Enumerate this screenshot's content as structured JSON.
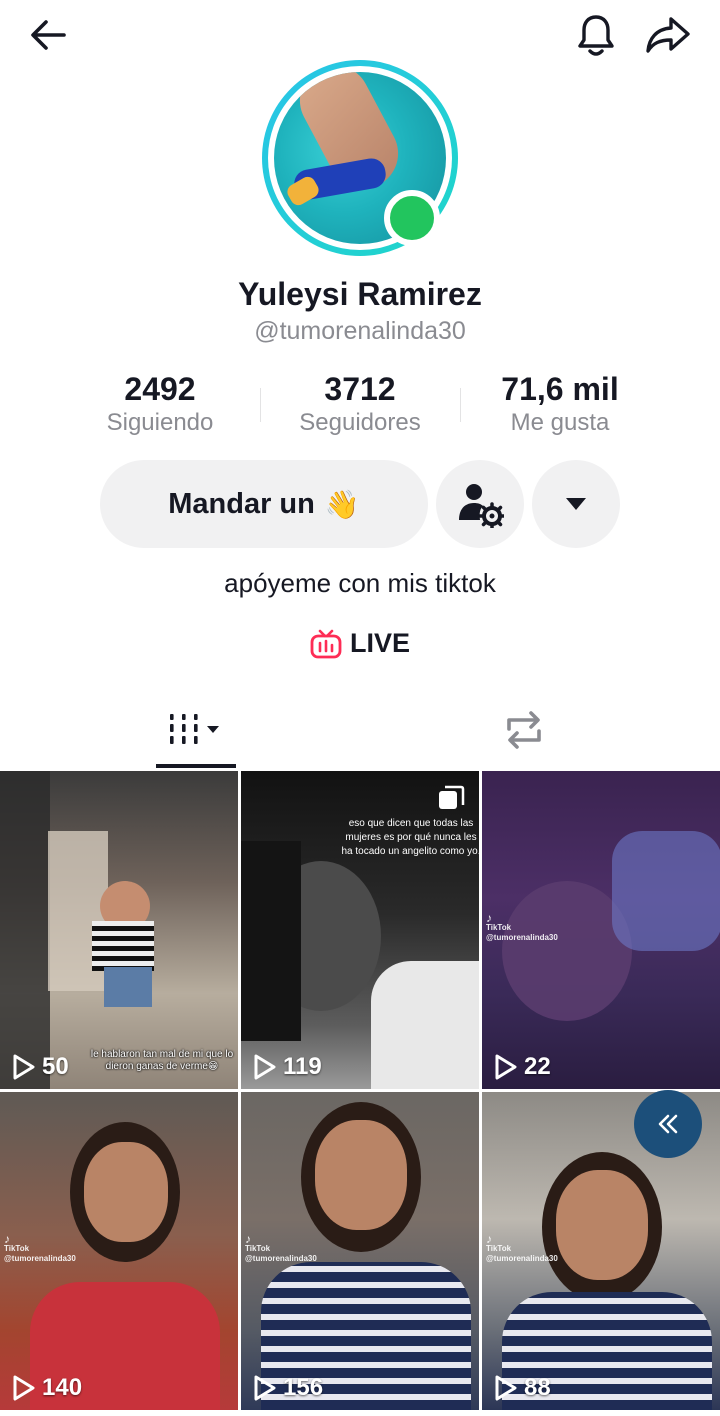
{
  "header": {
    "back_icon": "arrow-left-icon",
    "notifications_icon": "bell-icon",
    "share_icon": "share-arrow-icon"
  },
  "profile": {
    "name": "Yuleysi Ramirez",
    "handle": "@tumorenalinda30",
    "bio": "apóyeme con mis tiktok",
    "online_color": "#22c55e",
    "ring_color": "#29c4e8"
  },
  "stats": [
    {
      "value": "2492",
      "label": "Siguiendo"
    },
    {
      "value": "3712",
      "label": "Seguidores"
    },
    {
      "value": "71,6 mil",
      "label": "Me gusta"
    }
  ],
  "actions": {
    "message_label": "Mandar un",
    "message_emoji": "👋",
    "friends_icon": "user-settings-icon",
    "more_icon": "caret-down-icon"
  },
  "live": {
    "label": "LIVE",
    "color": "#fe2c55"
  },
  "tabs": {
    "videos_icon": "grid-columns-icon",
    "repost_icon": "repost-icon"
  },
  "videos": [
    {
      "views": "50",
      "caption": "le hablaron tan mal de mi que lo dieron ganas de verme😁"
    },
    {
      "views": "119",
      "quote": "eso que dicen que todas las mujeres es por qué nunca les ha tocado un angelito como yo."
    },
    {
      "views": "22",
      "watermark": "TikTok",
      "watermark_user": "@tumorenalinda30"
    },
    {
      "views": "140",
      "watermark": "TikTok",
      "watermark_user": "@tumorenalinda30"
    },
    {
      "views": "156",
      "watermark": "TikTok",
      "watermark_user": "@tumorenalinda30"
    },
    {
      "views": "88",
      "watermark": "TikTok",
      "watermark_user": "@tumorenalinda30"
    }
  ]
}
